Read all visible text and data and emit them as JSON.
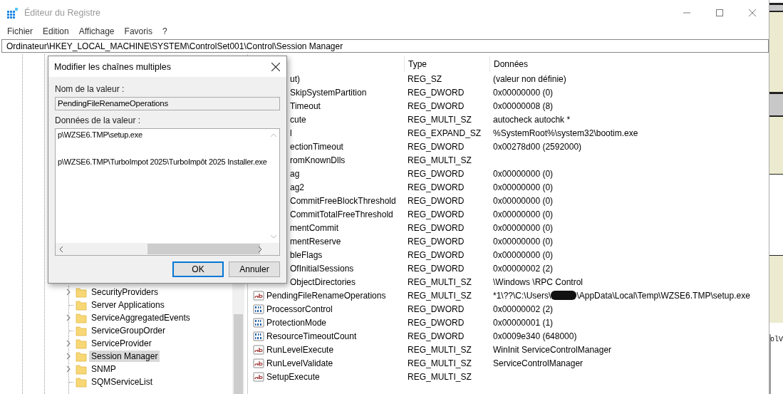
{
  "window": {
    "title": "Éditeur du Registre",
    "active": false
  },
  "menu": [
    "Fichier",
    "Edition",
    "Affichage",
    "Favoris",
    "?"
  ],
  "address": "Ordinateur\\HKEY_LOCAL_MACHINE\\SYSTEM\\ControlSet001\\Control\\Session Manager",
  "tree": {
    "items": [
      {
        "name": "SecurityProviders",
        "expandable": true,
        "selected": false
      },
      {
        "name": "Server Applications",
        "expandable": false,
        "selected": false
      },
      {
        "name": "ServiceAggregatedEvents",
        "expandable": true,
        "selected": false
      },
      {
        "name": "ServiceGroupOrder",
        "expandable": false,
        "selected": false
      },
      {
        "name": "ServiceProvider",
        "expandable": true,
        "selected": false
      },
      {
        "name": "Session Manager",
        "expandable": true,
        "selected": true
      },
      {
        "name": "SNMP",
        "expandable": true,
        "selected": false
      },
      {
        "name": "SQMServiceList",
        "expandable": false,
        "selected": false
      }
    ]
  },
  "list": {
    "columns": [
      "Type",
      "Données"
    ],
    "rows": [
      {
        "name": "ut)",
        "type": "REG_SZ",
        "data": "(valeur non définie)"
      },
      {
        "name": "SkipSystemPartition",
        "type": "REG_DWORD",
        "data": "0x00000000 (0)"
      },
      {
        "name": "Timeout",
        "type": "REG_DWORD",
        "data": "0x00000008 (8)"
      },
      {
        "name": "cute",
        "type": "REG_MULTI_SZ",
        "data": "autocheck autochk *"
      },
      {
        "name": "l",
        "type": "REG_EXPAND_SZ",
        "data": "%SystemRoot%\\system32\\bootim.exe"
      },
      {
        "name": "ectionTimeout",
        "type": "REG_DWORD",
        "data": "0x00278d00 (2592000)"
      },
      {
        "name": "romKnownDlls",
        "type": "REG_MULTI_SZ"
      },
      {
        "name": "ag",
        "type": "REG_DWORD",
        "data": "0x00000000 (0)"
      },
      {
        "name": "ag2",
        "type": "REG_DWORD",
        "data": "0x00000000 (0)"
      },
      {
        "name": "CommitFreeBlockThreshold",
        "type": "REG_DWORD",
        "data": "0x00000000 (0)"
      },
      {
        "name": "CommitTotalFreeThreshold",
        "type": "REG_DWORD",
        "data": "0x00000000 (0)"
      },
      {
        "name": "mentCommit",
        "type": "REG_DWORD",
        "data": "0x00000000 (0)"
      },
      {
        "name": "mentReserve",
        "type": "REG_DWORD",
        "data": "0x00000000 (0)"
      },
      {
        "name": "bleFlags",
        "type": "REG_DWORD",
        "data": "0x00000000 (0)"
      },
      {
        "name": "OfInitialSessions",
        "type": "REG_DWORD",
        "data": "0x00000002 (2)"
      },
      {
        "name": "ObjectDirectories",
        "type": "REG_MULTI_SZ",
        "data": "\\Windows \\RPC Control"
      },
      {
        "name": "PendingFileRenameOperations",
        "kind": "string",
        "type": "REG_MULTI_SZ",
        "data": "*1\\??\\C:\\Users\\",
        "redacted": true,
        "data_tail": "\\AppData\\Local\\Temp\\WZSE6.TMP\\setup.exe"
      },
      {
        "name": "ProcessorControl",
        "kind": "number",
        "type": "REG_DWORD",
        "data": "0x00000002 (2)"
      },
      {
        "name": "ProtectionMode",
        "kind": "number",
        "type": "REG_DWORD",
        "data": "0x00000001 (1)"
      },
      {
        "name": "ResourceTimeoutCount",
        "kind": "number",
        "type": "REG_DWORD",
        "data": "0x0009e340 (648000)"
      },
      {
        "name": "RunLevelExecute",
        "kind": "string",
        "type": "REG_MULTI_SZ",
        "data": "WinInit ServiceControlManager"
      },
      {
        "name": "RunLevelValidate",
        "kind": "string",
        "type": "REG_MULTI_SZ",
        "data": "ServiceControlManager"
      },
      {
        "name": "SetupExecute",
        "kind": "string",
        "type": "REG_MULTI_SZ"
      }
    ]
  },
  "dialog": {
    "title": "Modifier les chaînes multiples",
    "name_label": "Nom de la valeur :",
    "name_value": "PendingFileRenameOperations",
    "data_label": "Données de la valeur :",
    "data_lines": [
      "p\\WZSE6.TMP\\setup.exe",
      "p\\WZSE6.TMP\\TurboImpot 2025\\TurboImpôt 2025 Installer.exe"
    ],
    "buttons": [
      {
        "label": "OK",
        "default": true
      },
      {
        "label": "Annuler",
        "default": false
      }
    ]
  },
  "backdrop_text": "olV"
}
